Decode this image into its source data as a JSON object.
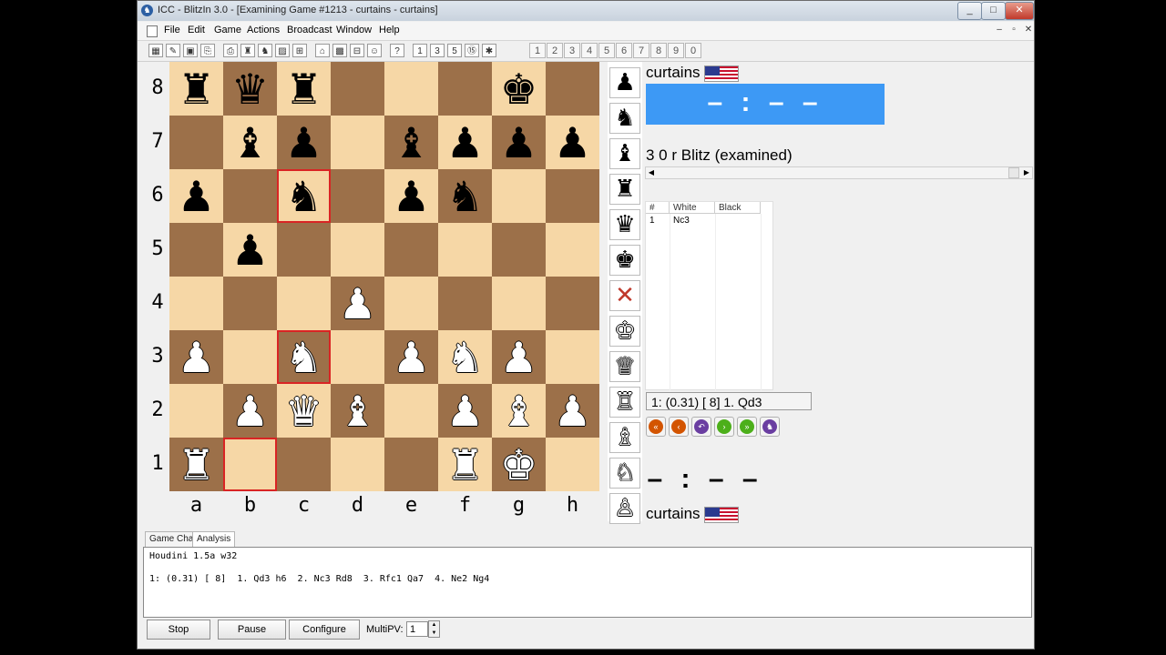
{
  "window": {
    "title": "ICC - BlitzIn 3.0 - [Examining Game #1213 - curtains - curtains]",
    "controls": [
      "_",
      "□",
      "✕"
    ],
    "mdi_controls": [
      "–",
      "▫",
      "✕"
    ]
  },
  "menu": [
    "File",
    "Edit",
    "Game",
    "Actions",
    "Broadcast",
    "Window",
    "Help"
  ],
  "toolbar": {
    "icons": [
      "open-icon",
      "edit-icon",
      "save-icon",
      "copy-icon",
      "print-icon",
      "board-icon",
      "engine-icon",
      "chart-icon",
      "tile-icon",
      "house-icon",
      "grid-icon",
      "arrange-icon",
      "user-icon",
      "help-icon",
      "seek-1-icon",
      "seek-3-icon",
      "seek-5-icon",
      "seek-15-icon",
      "seek-custom-icon"
    ],
    "number_buttons": [
      "1",
      "2",
      "3",
      "4",
      "5",
      "6",
      "7",
      "8",
      "9",
      "0"
    ]
  },
  "board": {
    "ranks": [
      "8",
      "7",
      "6",
      "5",
      "4",
      "3",
      "2",
      "1"
    ],
    "files": [
      "a",
      "b",
      "c",
      "d",
      "e",
      "f",
      "g",
      "h"
    ],
    "position": [
      [
        "r",
        "q",
        "r",
        "",
        "",
        "",
        "k",
        ""
      ],
      [
        "",
        "b",
        "p",
        "",
        "b",
        "p",
        "p",
        "p"
      ],
      [
        "p",
        "",
        "n",
        "",
        "p",
        "n",
        "",
        ""
      ],
      [
        "",
        "p",
        "",
        "",
        "",
        "",
        "",
        ""
      ],
      [
        "",
        "",
        "",
        "P",
        "",
        "",
        "",
        ""
      ],
      [
        "P",
        "",
        "N",
        "",
        "P",
        "N",
        "P",
        ""
      ],
      [
        "",
        "P",
        "Q",
        "B",
        "",
        "P",
        "B",
        "P"
      ],
      [
        "R",
        "",
        "",
        "",
        "",
        "R",
        "K",
        ""
      ]
    ],
    "highlighted": [
      "c6",
      "c3",
      "b1"
    ]
  },
  "palette": {
    "black": [
      "♟",
      "♞",
      "♝",
      "♜",
      "♛",
      "♚"
    ],
    "clear": "✕",
    "white": [
      "♔",
      "♕",
      "♖",
      "♗",
      "♘",
      "♙"
    ]
  },
  "top_player": {
    "name": "curtains",
    "clock": "– : – –"
  },
  "bottom_player": {
    "name": "curtains",
    "clock": "– : – –"
  },
  "game_info": "3 0 r Blitz (examined)",
  "moves_table": {
    "headers": [
      "#",
      "White",
      "Black"
    ],
    "rows": [
      {
        "num": "1",
        "white": "Nc3",
        "black": ""
      }
    ]
  },
  "eval_line": "1: (0.31) [ 8]  1. Qd3",
  "nav_buttons": [
    {
      "name": "first-move-icon",
      "glyph": "«",
      "color": "#d35400"
    },
    {
      "name": "prev-move-icon",
      "glyph": "‹",
      "color": "#d35400"
    },
    {
      "name": "back-icon",
      "glyph": "↶",
      "color": "#6a3ea1"
    },
    {
      "name": "next-move-icon",
      "glyph": "›",
      "color": "#4caf1a"
    },
    {
      "name": "last-move-icon",
      "glyph": "»",
      "color": "#4caf1a"
    },
    {
      "name": "engine-icon",
      "glyph": "♞",
      "color": "#6a3ea1"
    }
  ],
  "tabs": [
    "Game Chat",
    "Analysis"
  ],
  "analysis": {
    "engine": "Houdini 1.5a w32",
    "line": "1: (0.31) [ 8]  1. Qd3 h6  2. Nc3 Rd8  3. Rfc1 Qa7  4. Ne2 Ng4"
  },
  "buttons": {
    "stop": "Stop",
    "pause": "Pause",
    "configure": "Configure"
  },
  "multipv": {
    "label": "MultiPV:",
    "value": "1"
  },
  "colors": {
    "light_square": "#f6d7a6",
    "dark_square": "#9c7049",
    "highlight": "#d92424",
    "clock_active": "#3d99f5"
  }
}
